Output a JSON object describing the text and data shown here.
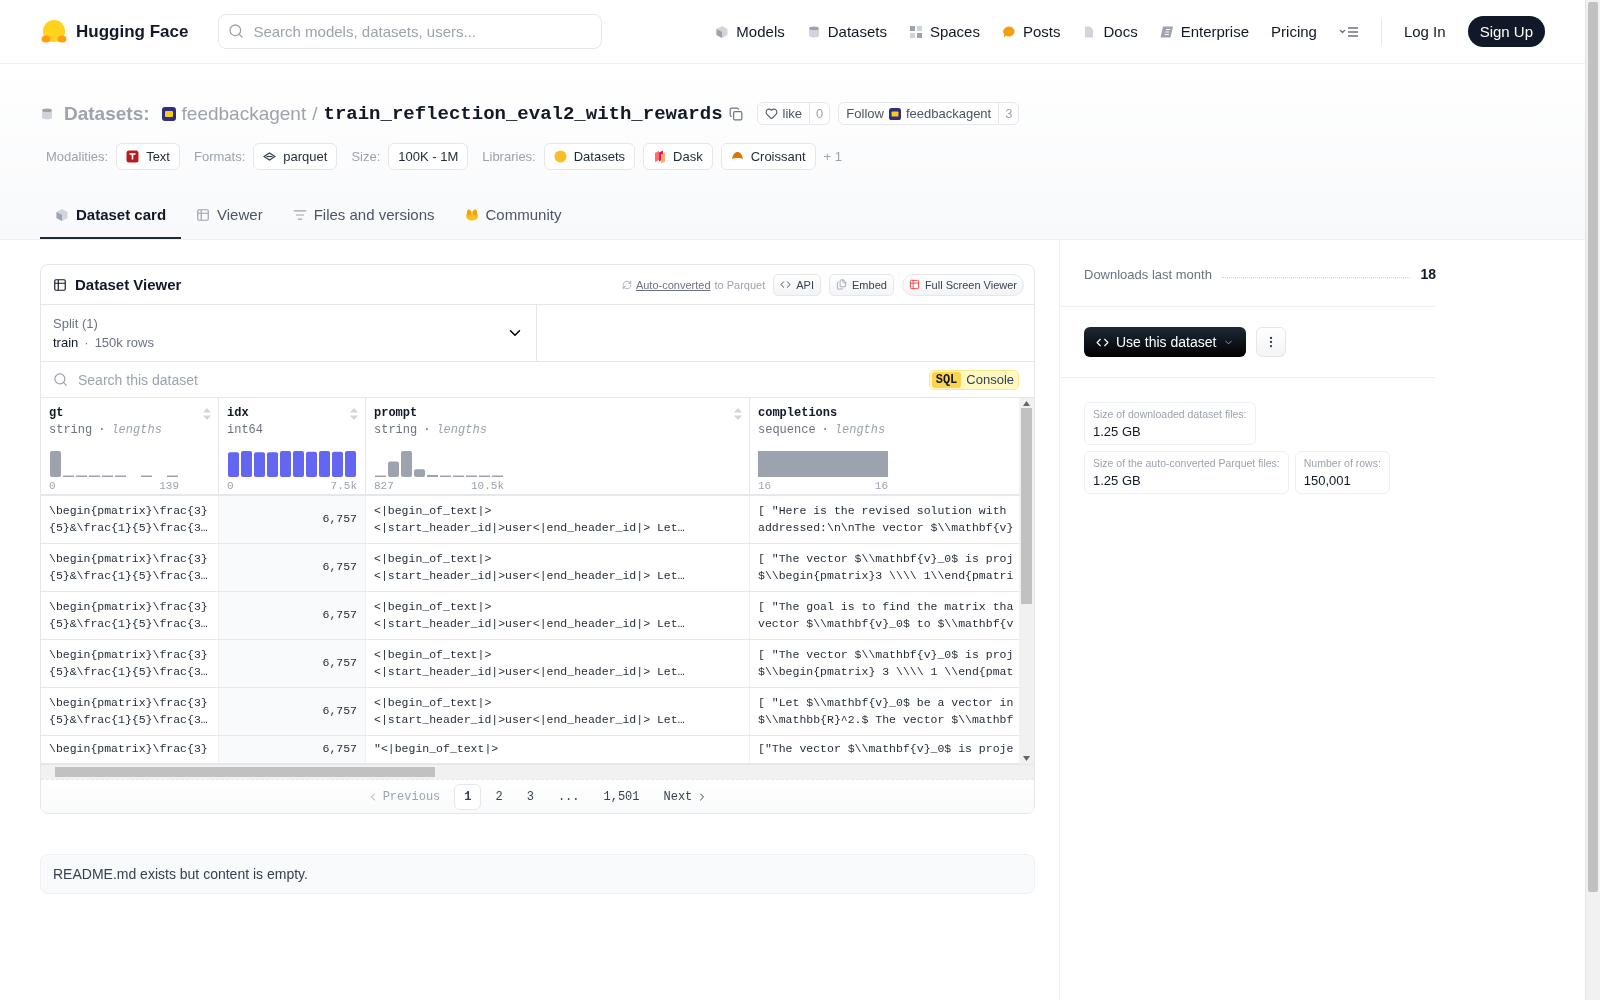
{
  "header": {
    "brand": "Hugging Face",
    "search": {
      "placeholder": "Search models, datasets, users..."
    },
    "nav": [
      {
        "label": "Models",
        "kind": "cube"
      },
      {
        "label": "Datasets",
        "kind": "database"
      },
      {
        "label": "Spaces",
        "kind": "grid"
      },
      {
        "label": "Posts",
        "kind": "bubble"
      },
      {
        "label": "Docs",
        "kind": "doc"
      },
      {
        "label": "Enterprise",
        "kind": "enterprise"
      },
      {
        "label": "Pricing",
        "kind": "plain"
      }
    ],
    "login": "Log In",
    "signup": "Sign Up"
  },
  "repo": {
    "section": "Datasets:",
    "owner": "feedbackagent",
    "separator": "/",
    "name": "train_reflection_eval2_with_rewards",
    "like": {
      "label": "like",
      "count": "0"
    },
    "follow": {
      "label": "Follow",
      "user": "feedbackagent",
      "count": "3"
    }
  },
  "tags": [
    {
      "label": "Modalities:",
      "items": [
        {
          "text": "Text",
          "kind": "text"
        }
      ]
    },
    {
      "label": "Formats:",
      "items": [
        {
          "text": "parquet",
          "kind": "parquet"
        }
      ]
    },
    {
      "label": "Size:",
      "items": [
        {
          "text": "100K - 1M",
          "kind": "plain"
        }
      ]
    },
    {
      "label": "Libraries:",
      "items": [
        {
          "text": "Datasets",
          "kind": "hf"
        },
        {
          "text": "Dask",
          "kind": "dask"
        },
        {
          "text": "Croissant",
          "kind": "croissant"
        }
      ],
      "more": "+ 1"
    }
  ],
  "tabs": [
    {
      "label": "Dataset card",
      "kind": "cube",
      "selected": true
    },
    {
      "label": "Viewer",
      "kind": "table",
      "selected": false
    },
    {
      "label": "Files and versions",
      "kind": "files",
      "selected": false
    },
    {
      "label": "Community",
      "kind": "hands",
      "selected": false
    }
  ],
  "viewer": {
    "title": "Dataset Viewer",
    "converted": {
      "link": "Auto-converted",
      "rest": "to Parquet"
    },
    "actions": [
      {
        "label": "API",
        "kind": "code"
      },
      {
        "label": "Embed",
        "kind": "embed"
      },
      {
        "label": "Full Screen Viewer",
        "kind": "table"
      }
    ],
    "split": {
      "label": "Split (1)",
      "value": "train",
      "separator": "·",
      "rows": "150k rows"
    },
    "search": {
      "placeholder": "Search this dataset"
    },
    "sql": {
      "badge": "SQL",
      "label": "Console"
    },
    "columns": [
      {
        "name": "gt",
        "type": "string",
        "separator": "·",
        "stat": "lengths",
        "min": "0",
        "max": "139",
        "kind": "skewed",
        "sortable": true
      },
      {
        "name": "idx",
        "type": "int64",
        "min": "0",
        "max": "7.5k",
        "kind": "uniform",
        "sortable": true
      },
      {
        "name": "prompt",
        "type": "string",
        "separator": "·",
        "stat": "lengths",
        "min": "827",
        "max": "10.5k",
        "kind": "peaked",
        "sortable": true
      },
      {
        "name": "completions",
        "type": "sequence",
        "separator": "·",
        "stat": "lengths",
        "min": "16",
        "max": "16",
        "kind": "single",
        "sortable": false
      }
    ],
    "rows": [
      [
        "\\begin{pmatrix}\\frac{3}\n{5}&\\frac{1}{5}\\frac{3…",
        "6,757",
        "<|begin_of_text|>\n<|start_header_id|>user<|end_header_id|> Let…",
        "[ \"Here is the revised solution with\naddressed:\\n\\nThe vector $\\\\mathbf{v}"
      ],
      [
        "\\begin{pmatrix}\\frac{3}\n{5}&\\frac{1}{5}\\frac{3…",
        "6,757",
        "<|begin_of_text|>\n<|start_header_id|>user<|end_header_id|> Let…",
        "[ \"The vector $\\\\mathbf{v}_0$ is proj\n$\\\\begin{pmatrix}3 \\\\\\\\ 1\\\\end{pmatri"
      ],
      [
        "\\begin{pmatrix}\\frac{3}\n{5}&\\frac{1}{5}\\frac{3…",
        "6,757",
        "<|begin_of_text|>\n<|start_header_id|>user<|end_header_id|> Let…",
        "[ \"The goal is to find the matrix tha\nvector $\\\\mathbf{v}_0$ to $\\\\mathbf{v"
      ],
      [
        "\\begin{pmatrix}\\frac{3}\n{5}&\\frac{1}{5}\\frac{3…",
        "6,757",
        "<|begin_of_text|>\n<|start_header_id|>user<|end_header_id|> Let…",
        "[ \"The vector $\\\\mathbf{v}_0$ is proj\n$\\\\begin{pmatrix} 3 \\\\\\\\ 1 \\\\end{pmat"
      ],
      [
        "\\begin{pmatrix}\\frac{3}\n{5}&\\frac{1}{5}\\frac{3…",
        "6,757",
        "<|begin_of_text|>\n<|start_header_id|>user<|end_header_id|> Let…",
        "[ \"Let $\\\\mathbf{v}_0$ be a vector in\n$\\\\mathbb{R}^2.$ The vector $\\\\mathbf"
      ],
      [
        "\\begin{pmatrix}\\frac{3}",
        "6,757",
        "\"<|begin_of_text|>",
        "[\"The vector $\\\\mathbf{v}_0$ is proje"
      ]
    ],
    "pagination": {
      "previous": {
        "label": "Previous",
        "disabled": true
      },
      "pages": [
        {
          "label": "1",
          "selected": true
        },
        {
          "label": "2",
          "selected": false
        },
        {
          "label": "3",
          "selected": false
        },
        {
          "label": "...",
          "selected": false
        },
        {
          "label": "1,501",
          "selected": false
        }
      ],
      "next": {
        "label": "Next",
        "disabled": false
      }
    }
  },
  "readme": "README.md exists but content is empty.",
  "sidebar": {
    "downloads": {
      "label": "Downloads last month",
      "value": "18"
    },
    "use_button": "Use this dataset",
    "stats": [
      {
        "label": "Size of downloaded dataset files:",
        "value": "1.25 GB"
      },
      {
        "label": "Size of the auto-converted Parquet files:",
        "value": "1.25 GB"
      },
      {
        "label": "Number of rows:",
        "value": "150,001"
      }
    ]
  }
}
